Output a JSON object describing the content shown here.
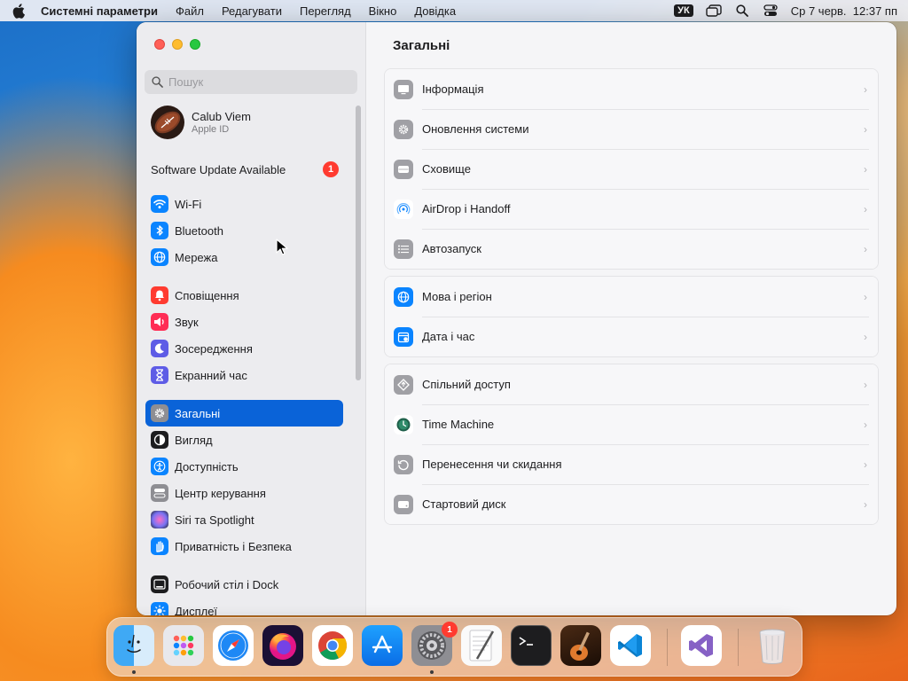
{
  "menubar": {
    "app_name": "Системні параметри",
    "menus": [
      "Файл",
      "Редагувати",
      "Перегляд",
      "Вікно",
      "Довідка"
    ],
    "keyboard_layout": "УК",
    "datetime": "Ср 7 черв.  12:37 пп"
  },
  "sidebar": {
    "search_placeholder": "Пошук",
    "account": {
      "name": "Calub Viem",
      "subtitle": "Apple ID"
    },
    "update": {
      "label": "Software Update Available",
      "badge": "1"
    },
    "items": [
      {
        "label": "Wi-Fi",
        "icon": "wifi-icon",
        "color": "#0a84ff"
      },
      {
        "label": "Bluetooth",
        "icon": "bluetooth-icon",
        "color": "#0a84ff"
      },
      {
        "label": "Мережа",
        "icon": "globe-icon",
        "color": "#0a84ff"
      },
      {
        "label": "Сповіщення",
        "icon": "bell-icon",
        "color": "#ff3b30"
      },
      {
        "label": "Звук",
        "icon": "speaker-icon",
        "color": "#ff2d55"
      },
      {
        "label": "Зосередження",
        "icon": "moon-icon",
        "color": "#5e5ce6"
      },
      {
        "label": "Екранний час",
        "icon": "hourglass-icon",
        "color": "#5e5ce6"
      },
      {
        "label": "Загальні",
        "icon": "gear-icon",
        "color": "#8e8e93",
        "active": true
      },
      {
        "label": "Вигляд",
        "icon": "appearance-icon",
        "color": "#1d1d1f"
      },
      {
        "label": "Доступність",
        "icon": "accessibility-icon",
        "color": "#0a84ff"
      },
      {
        "label": "Центр керування",
        "icon": "toggles-icon",
        "color": "#8e8e93"
      },
      {
        "label": "Siri та Spotlight",
        "icon": "siri-icon",
        "color": "#b44cd8"
      },
      {
        "label": "Приватність і Безпека",
        "icon": "hand-icon",
        "color": "#0a84ff"
      },
      {
        "label": "Робочий стіл і Dock",
        "icon": "dock-icon",
        "color": "#1d1d1f"
      },
      {
        "label": "Дисплеї",
        "icon": "sun-icon",
        "color": "#0a84ff"
      }
    ]
  },
  "main": {
    "title": "Загальні",
    "groups": [
      [
        {
          "label": "Інформація",
          "icon": "computer-icon"
        },
        {
          "label": "Оновлення системи",
          "icon": "gear-update-icon"
        },
        {
          "label": "Сховище",
          "icon": "drive-icon"
        },
        {
          "label": "AirDrop і Handoff",
          "icon": "airdrop-icon"
        },
        {
          "label": "Автозапуск",
          "icon": "list-icon"
        }
      ],
      [
        {
          "label": "Мова і регіон",
          "icon": "globe-icon"
        },
        {
          "label": "Дата і час",
          "icon": "calendar-icon"
        }
      ],
      [
        {
          "label": "Спільний доступ",
          "icon": "sharing-icon"
        },
        {
          "label": "Time Machine",
          "icon": "time-machine-icon"
        },
        {
          "label": "Перенесення чи скидання",
          "icon": "reset-icon"
        },
        {
          "label": "Стартовий диск",
          "icon": "startup-disk-icon"
        }
      ]
    ]
  },
  "dock": {
    "apps": [
      "finder",
      "launchpad",
      "safari",
      "firefox",
      "chrome",
      "app-store",
      "system-settings",
      "textedit",
      "terminal",
      "garageband",
      "vscode",
      "visual-studio",
      "trash"
    ],
    "settings_badge": "1"
  }
}
